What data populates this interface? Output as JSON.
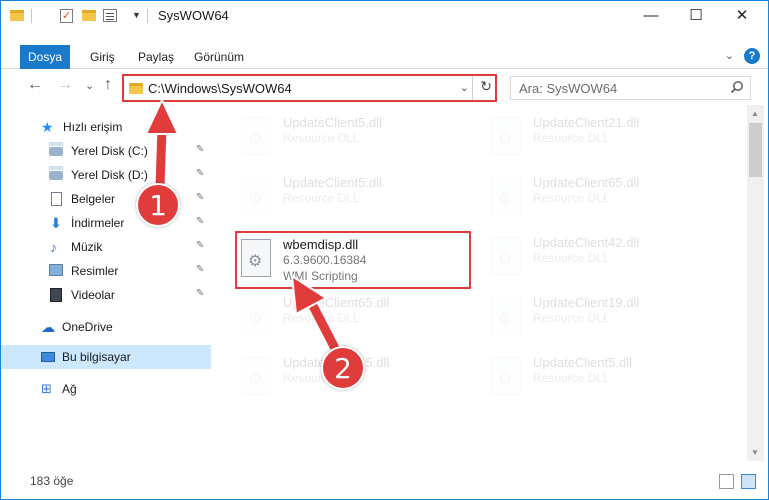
{
  "window": {
    "title": "SysWOW64",
    "minimize_symbol": "—",
    "maximize_symbol": "☐",
    "close_symbol": "✕"
  },
  "ribbon": {
    "tabs": [
      {
        "label": "Dosya",
        "active": true
      },
      {
        "label": "Giriş",
        "active": false
      },
      {
        "label": "Paylaş",
        "active": false
      },
      {
        "label": "Görünüm",
        "active": false
      }
    ],
    "help": "?",
    "collapse": "⌄"
  },
  "address_bar": {
    "path": "C:\\Windows\\SysWOW64",
    "dropdown": "⌄",
    "refresh": "↻"
  },
  "nav": {
    "back": "←",
    "forward": "→",
    "recent": "⌄",
    "up": "↑"
  },
  "search": {
    "placeholder": "Ara: SysWOW64"
  },
  "sidebar": {
    "items": [
      {
        "label": "Hızlı erişim",
        "icon": "star-icon",
        "pinned": false
      },
      {
        "label": "Yerel Disk (C:)",
        "icon": "drive-icon",
        "pinned": true
      },
      {
        "label": "Yerel Disk (D:)",
        "icon": "drive-icon",
        "pinned": true
      },
      {
        "label": "Belgeler",
        "icon": "documents-icon",
        "pinned": true
      },
      {
        "label": "İndirmeler",
        "icon": "download-icon",
        "pinned": true
      },
      {
        "label": "Müzik",
        "icon": "music-icon",
        "pinned": true
      },
      {
        "label": "Resimler",
        "icon": "pictures-icon",
        "pinned": true
      },
      {
        "label": "Videolar",
        "icon": "videos-icon",
        "pinned": true
      },
      {
        "label": "OneDrive",
        "icon": "cloud-icon",
        "pinned": false
      },
      {
        "label": "Bu bilgisayar",
        "icon": "computer-icon",
        "pinned": false,
        "selected": true
      },
      {
        "label": "Ağ",
        "icon": "network-icon",
        "pinned": false
      }
    ],
    "pin_glyph": "📌"
  },
  "files": {
    "left_column": [
      {
        "name": "UpdateClient5.dll",
        "description": "Resource DLL",
        "faded": true
      },
      {
        "name": "UpdateClient5.dll",
        "description": "Resource DLL",
        "faded": true
      },
      {
        "name": "wbemdisp.dll",
        "version": "6.3.9600.16384",
        "description": "WMI Scripting",
        "faded": false,
        "highlighted": true
      },
      {
        "name": "UpdateClient65.dll",
        "description": "Resource DLL",
        "faded": true
      },
      {
        "name": "UpdateClient65.dll",
        "description": "Resource DLL",
        "faded": true
      }
    ],
    "right_column": [
      {
        "name": "UpdateClient21.dll",
        "description": "Resource DLL",
        "faded": true
      },
      {
        "name": "UpdateClient65.dll",
        "description": "Resource DLL",
        "faded": true
      },
      {
        "name": "UpdateClient42.dll",
        "description": "Resource DLL",
        "faded": true
      },
      {
        "name": "UpdateClient19.dll",
        "description": "Resource DLL",
        "faded": true
      },
      {
        "name": "UpdateClient5.dll",
        "description": "Resource DLL",
        "faded": true
      }
    ]
  },
  "status_bar": {
    "item_count": "183 öğe"
  },
  "annotations": {
    "step1": "1",
    "step2": "2",
    "color": "#e03c3c"
  }
}
